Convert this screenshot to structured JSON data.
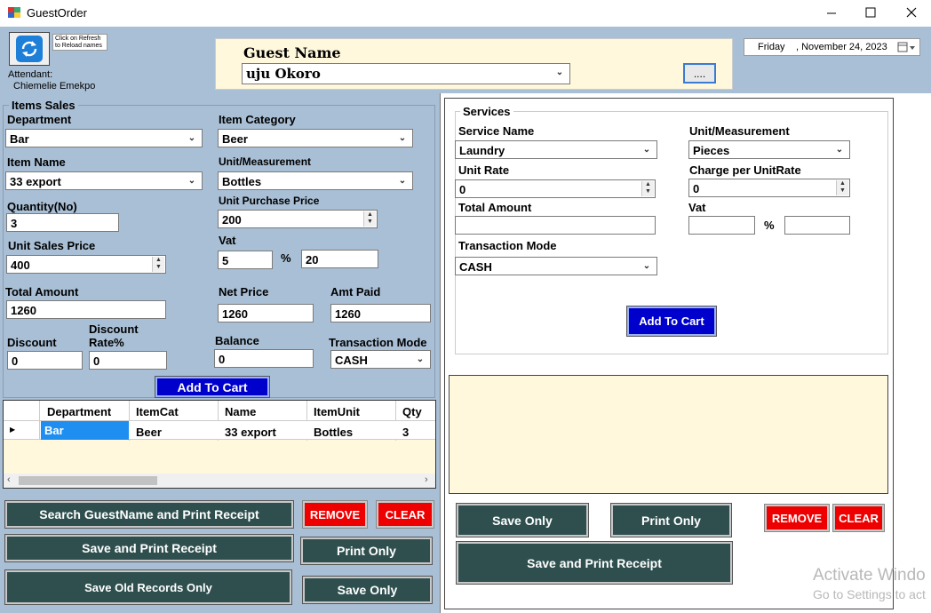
{
  "window": {
    "title": "GuestOrder"
  },
  "header": {
    "refresh_hint": "Click on Refresh to Reload names",
    "attendant_label": "Attendant:",
    "attendant_name": "Chiemelie Emekpo",
    "guest_name_label": "Guest Name",
    "guest_name_value": "uju Okoro",
    "dots_button": "....",
    "date_day": "Friday",
    "date_rest": ", November 24, 2023"
  },
  "items": {
    "group_title": "Items Sales",
    "department_label": "Department",
    "department_value": "Bar",
    "category_label": "Item Category",
    "category_value": "Beer",
    "name_label": "Item Name",
    "name_value": "33 export",
    "unit_label": "Unit/Measurement",
    "unit_value": "Bottles",
    "qty_label": "Quantity(No)",
    "qty_value": "3",
    "purchase_label": "Unit Purchase Price",
    "purchase_value": "200",
    "sales_label": "Unit Sales Price",
    "sales_value": "400",
    "vat_label": "Vat",
    "vat_value": "5",
    "vat_percent_sign": "%",
    "vat_amount": "20",
    "total_label": "Total Amount",
    "total_value": "1260",
    "net_label": "Net Price",
    "net_value": "1260",
    "paid_label": "Amt Paid",
    "paid_value": "1260",
    "discount_label": "Discount",
    "discount_value": "0",
    "discount_rate_label": "Discount Rate%",
    "discount_rate_value": "0",
    "balance_label": "Balance",
    "balance_value": "0",
    "mode_label": "Transaction Mode",
    "mode_value": "CASH",
    "add_to_cart": "Add To Cart",
    "grid": {
      "columns": [
        "Department",
        "ItemCat",
        "Name",
        "ItemUnit",
        "Qty"
      ],
      "rows": [
        [
          "Bar",
          "Beer",
          "33 export",
          "Bottles",
          "3"
        ]
      ]
    },
    "search_print_btn": "Search GuestName and Print Receipt",
    "remove_btn": "REMOVE",
    "clear_btn": "CLEAR",
    "save_print_btn": "Save and Print Receipt",
    "print_only_btn": "Print Only",
    "save_old_btn": "Save Old Records Only",
    "save_only_btn": "Save Only"
  },
  "services": {
    "group_title": "Services",
    "service_name_label": "Service Name",
    "service_name_value": "Laundry",
    "unit_label": "Unit/Measurement",
    "unit_value": "Pieces",
    "rate_label": "Unit Rate",
    "rate_value": "0",
    "charge_label": "Charge per UnitRate",
    "charge_value": "0",
    "total_label": "Total Amount",
    "total_value": "",
    "vat_label": "Vat",
    "vat_value": "",
    "vat_percent_sign": "%",
    "vat_amount": "",
    "mode_label": "Transaction Mode",
    "mode_value": "CASH",
    "add_to_cart": "Add To Cart",
    "save_only_btn": "Save Only",
    "print_only_btn": "Print Only",
    "remove_btn": "REMOVE",
    "clear_btn": "CLEAR",
    "save_print_btn": "Save and Print Receipt"
  },
  "watermark": {
    "line1": "Activate Windo",
    "line2": "Go to Settings to act"
  },
  "colors": {
    "header_bg": "#a9bfd5",
    "panel_border": "#3a3a3a",
    "dark_button": "#2f4f4f",
    "blue_button": "#0000cd",
    "red_button": "#ee0000",
    "note_bg": "#fff8dc"
  }
}
